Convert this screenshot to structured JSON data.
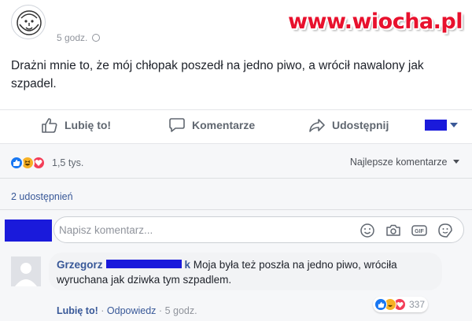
{
  "watermark": "www.wiocha.pl",
  "post": {
    "time": "5 godz.",
    "text": "Drażni mnie to, że mój chłopak poszedł na jedno piwo, a wrócił nawalony jak szpadel."
  },
  "actions": {
    "like": "Lubię to!",
    "comment": "Komentarze",
    "share": "Udostępnij"
  },
  "reactions": {
    "count": "1,5 tys.",
    "types": [
      "like-icon",
      "haha-icon",
      "love-icon"
    ]
  },
  "sort": {
    "label": "Najlepsze komentarze"
  },
  "shares": "2 udostępnień",
  "composer": {
    "placeholder": "Napisz komentarz..."
  },
  "comment": {
    "author": "Grzegorz",
    "author_tail": "k",
    "text": "Moja była też poszła na jedno piwo, wróciła wyruchana jak dziwka tym szpadlem.",
    "reaction_count": "337",
    "like_label": "Lubię to!",
    "reply_label": "Odpowiedz",
    "time": "5 godz."
  },
  "colors": {
    "link": "#385898",
    "watermark": "#e8112d",
    "redaction": "#1a1adb",
    "like": "#1877f2",
    "haha": "#f7b125",
    "love": "#f33e58"
  }
}
